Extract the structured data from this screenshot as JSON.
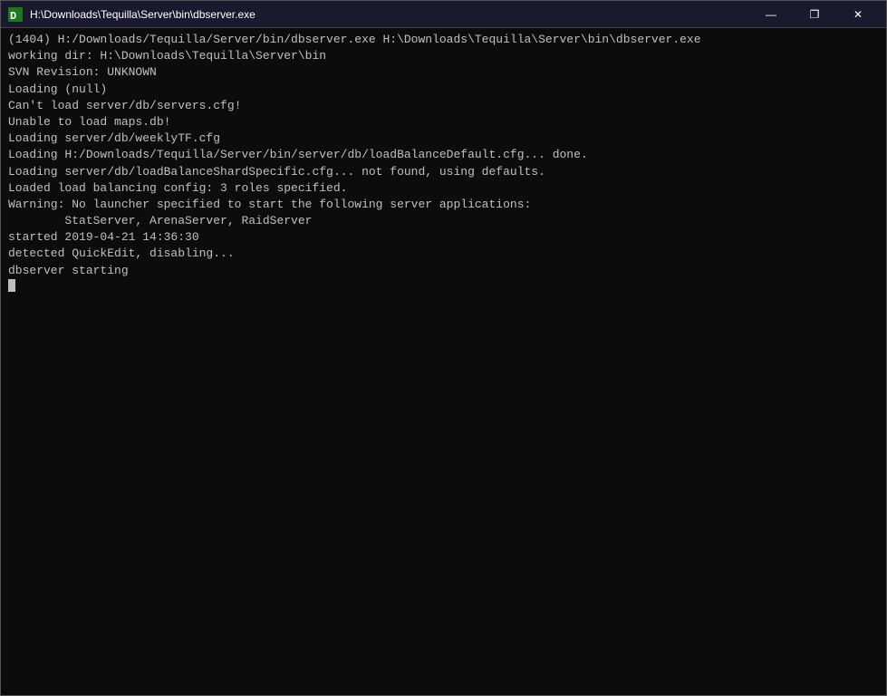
{
  "titlebar": {
    "title": "H:\\Downloads\\Tequilla\\Server\\bin\\dbserver.exe",
    "icon_color": "#4caf50",
    "minimize_label": "—",
    "restore_label": "❐",
    "close_label": "✕"
  },
  "console": {
    "lines": [
      "(1404) H:/Downloads/Tequilla/Server/bin/dbserver.exe H:\\Downloads\\Tequilla\\Server\\bin\\dbserver.exe",
      "working dir: H:\\Downloads\\Tequilla\\Server\\bin",
      "SVN Revision: UNKNOWN",
      "Loading (null)",
      "Can't load server/db/servers.cfg!",
      "Unable to load maps.db!",
      "Loading server/db/weeklyTF.cfg",
      "Loading H:/Downloads/Tequilla/Server/bin/server/db/loadBalanceDefault.cfg... done.",
      "Loading server/db/loadBalanceShardSpecific.cfg... not found, using defaults.",
      "Loaded load balancing config: 3 roles specified.",
      "Warning: No launcher specified to start the following server applications:",
      "        StatServer, ArenaServer, RaidServer",
      "started 2019-04-21 14:36:30",
      "detected QuickEdit, disabling...",
      "dbserver starting"
    ]
  }
}
